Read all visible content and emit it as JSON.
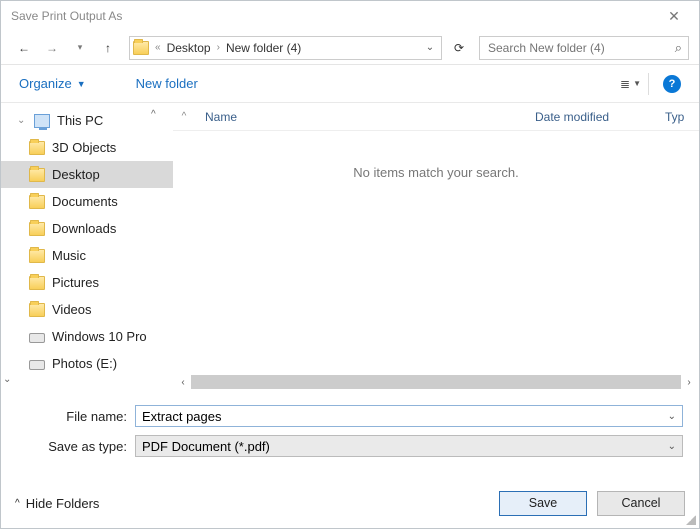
{
  "window": {
    "title": "Save Print Output As",
    "close": "✕"
  },
  "nav": {
    "back": "←",
    "forward": "→",
    "recent": "▾",
    "up": "↑",
    "crumbs": [
      "Desktop",
      "New folder (4)"
    ],
    "dropdown": "⌄",
    "refresh": "⟳",
    "search_placeholder": "Search New folder (4)"
  },
  "toolbar": {
    "organize": "Organize",
    "organize_caret": "▼",
    "new_folder": "New folder",
    "view_icon": "≣",
    "view_caret": "▼",
    "help": "?"
  },
  "sidebar": {
    "root": "This PC",
    "items": [
      {
        "label": "3D Objects"
      },
      {
        "label": "Desktop",
        "selected": true
      },
      {
        "label": "Documents"
      },
      {
        "label": "Downloads"
      },
      {
        "label": "Music"
      },
      {
        "label": "Pictures"
      },
      {
        "label": "Videos"
      },
      {
        "label": "Windows 10 Pro"
      },
      {
        "label": "Photos (E:)"
      }
    ]
  },
  "columns": {
    "sort": "^",
    "name": "Name",
    "date": "Date modified",
    "type": "Typ"
  },
  "content": {
    "empty": "No items match your search."
  },
  "form": {
    "filename_label": "File name:",
    "filename_value": "Extract pages",
    "type_label": "Save as type:",
    "type_value": "PDF Document (*.pdf)"
  },
  "footer": {
    "hide_caret": "^",
    "hide_label": "Hide Folders",
    "save": "Save",
    "cancel": "Cancel"
  }
}
